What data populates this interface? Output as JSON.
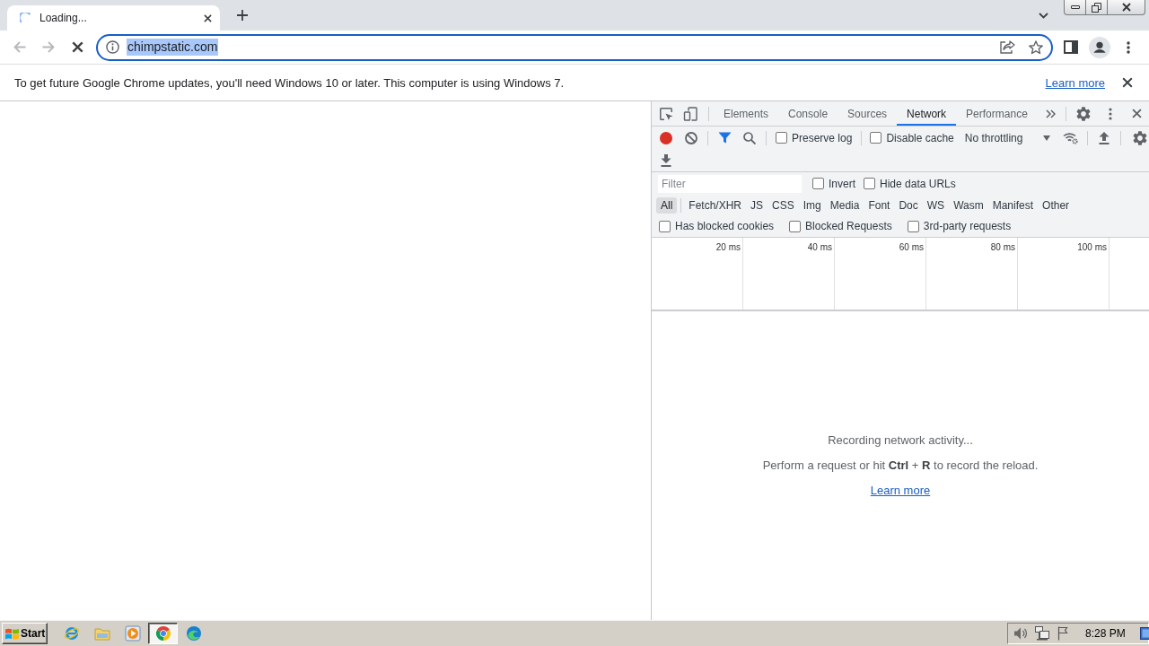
{
  "browser": {
    "tabs": [
      {
        "title": "Loading...",
        "loading": true,
        "selected": true
      }
    ],
    "toolbar": {
      "back": {
        "disabled": true
      },
      "forward": {
        "disabled": true
      }
    },
    "address_bar": {
      "value": "chimpstatic.com",
      "text_selected": true
    },
    "infobar": {
      "message": "To get future Google Chrome updates, you'll need Windows 10 or later. This computer is using Windows 7.",
      "link": "Learn more"
    }
  },
  "devtools": {
    "tabs": [
      {
        "label": "Elements",
        "selected": false
      },
      {
        "label": "Console",
        "selected": false
      },
      {
        "label": "Sources",
        "selected": false
      },
      {
        "label": "Network",
        "selected": true
      },
      {
        "label": "Performance",
        "selected": false
      }
    ],
    "toolbar": {
      "recording": true,
      "filter_active": true,
      "checkboxes": [
        {
          "label": "Preserve log",
          "checked": false
        },
        {
          "label": "Disable cache",
          "checked": false
        }
      ],
      "throttling": "No throttling"
    },
    "filter": {
      "placeholder": "Filter",
      "options": [
        {
          "label": "Invert",
          "checked": false
        },
        {
          "label": "Hide data URLs",
          "checked": false
        }
      ]
    },
    "resource_types": [
      {
        "label": "All",
        "selected": true
      },
      {
        "label": "Fetch/XHR",
        "selected": false
      },
      {
        "label": "JS",
        "selected": false
      },
      {
        "label": "CSS",
        "selected": false
      },
      {
        "label": "Img",
        "selected": false
      },
      {
        "label": "Media",
        "selected": false
      },
      {
        "label": "Font",
        "selected": false
      },
      {
        "label": "Doc",
        "selected": false
      },
      {
        "label": "WS",
        "selected": false
      },
      {
        "label": "Wasm",
        "selected": false
      },
      {
        "label": "Manifest",
        "selected": false
      },
      {
        "label": "Other",
        "selected": false
      }
    ],
    "request_filters": [
      {
        "label": "Has blocked cookies",
        "checked": false
      },
      {
        "label": "Blocked Requests",
        "checked": false
      },
      {
        "label": "3rd-party requests",
        "checked": false
      }
    ],
    "timeline": {
      "ticks": [
        "20 ms",
        "40 ms",
        "60 ms",
        "80 ms",
        "100 ms"
      ]
    },
    "empty_state": {
      "title": "Recording network activity...",
      "hint": "Perform a request or hit **Ctrl** + **R** to record the reload.",
      "link": "Learn more"
    }
  },
  "taskbar": {
    "start": "Start",
    "apps": [
      {
        "kind": "e-logo",
        "selected": false
      },
      {
        "kind": "folder",
        "selected": false
      },
      {
        "kind": "play",
        "selected": false
      },
      {
        "kind": "segmented-circle",
        "selected": true
      },
      {
        "kind": "swirl",
        "selected": false
      }
    ],
    "clock": "8:28 PM"
  }
}
